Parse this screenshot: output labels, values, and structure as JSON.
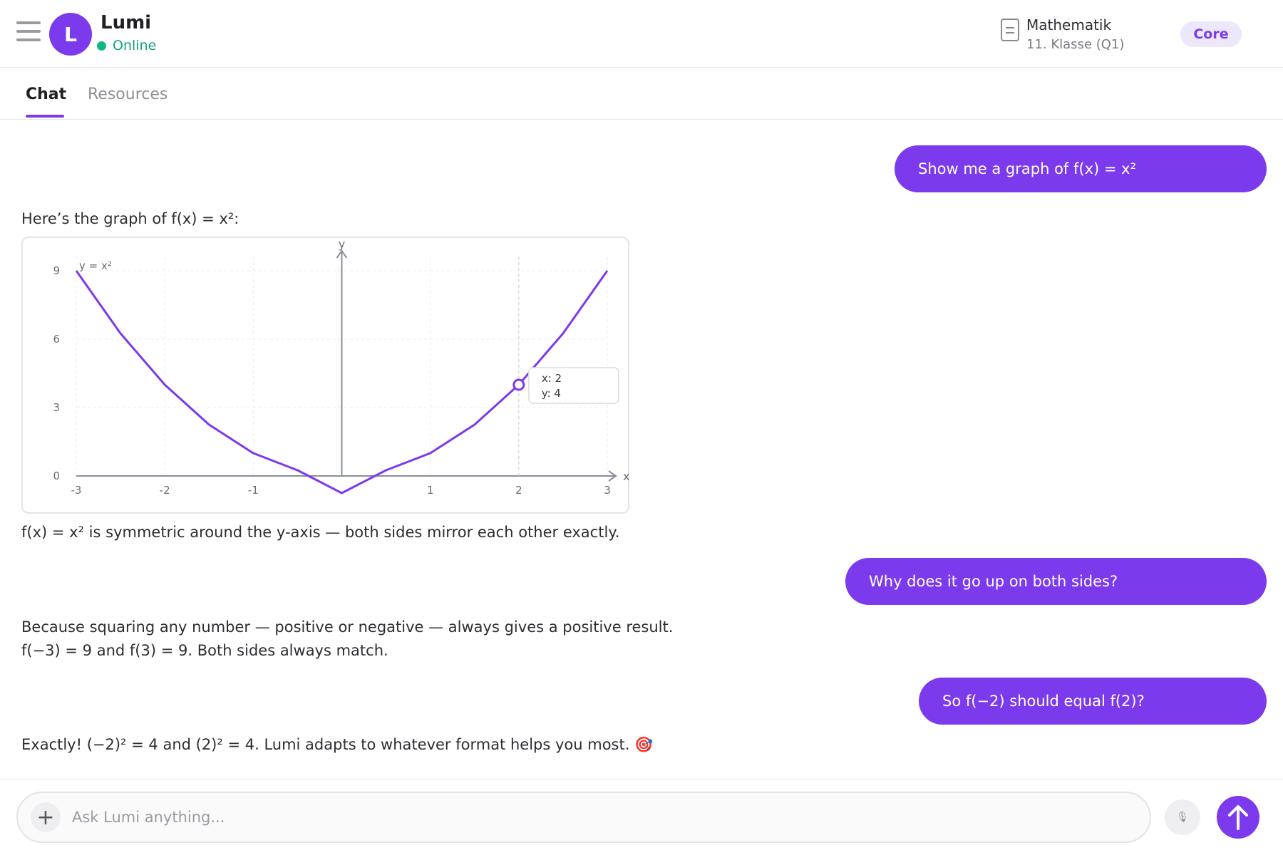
{
  "header": {
    "bot_name": "Lumi",
    "avatar_letter": "L",
    "status": "Online",
    "subject": "Mathematik",
    "grade": "11. Klasse (Q1)",
    "badge": "Core"
  },
  "tabs": [
    {
      "label": "Chat",
      "active": true
    },
    {
      "label": "Resources",
      "active": false
    }
  ],
  "messages": {
    "user_1": "Show me a graph of f(x) = x²",
    "bot_1_intro": "Here’s the graph of f(x) = x²:",
    "bot_1_note": "f(x) = x² is symmetric around the y-axis — both sides mirror each other exactly.",
    "user_2": "Why does it go up on both sides?",
    "bot_2_line1": "Because squaring any number — positive or negative — always gives a positive result.",
    "bot_2_line2": "f(−3) = 9 and f(3) = 9. Both sides always match.",
    "user_3": "So f(−2) should equal f(2)?",
    "bot_3": "Exactly! (−2)² = 4 and (2)² = 4. Lumi adapts to whatever format helps you most. 🎯"
  },
  "composer": {
    "placeholder": "Ask Lumi anything...",
    "plus_icon": "+",
    "mic_icon": "🎙"
  },
  "colors": {
    "accent": "#7c3aed",
    "online": "#10b981"
  },
  "chart_data": {
    "type": "line",
    "series_label": "y = x²",
    "x": [
      -3,
      -2.5,
      -2,
      -1.5,
      -1,
      -0.5,
      0,
      0.5,
      1,
      1.5,
      2,
      2.5,
      3
    ],
    "y": [
      9,
      6.25,
      4,
      2.25,
      1,
      0.25,
      -0.75,
      0.25,
      1,
      2.25,
      4,
      6.25,
      9
    ],
    "xticks": [
      "-3",
      "-2",
      "-1",
      "1",
      "2",
      "3"
    ],
    "yticks": [
      "0",
      "3",
      "6",
      "9"
    ],
    "xlabel": "x",
    "ylabel": "y",
    "xlim": [
      -3,
      3
    ],
    "ylim": [
      0,
      9
    ],
    "highlight": {
      "x": 2,
      "y": 4,
      "label_x": "x: 2",
      "label_y": "y: 4"
    }
  }
}
